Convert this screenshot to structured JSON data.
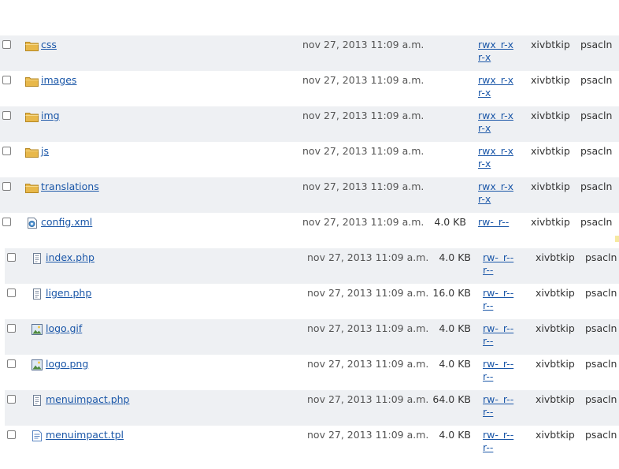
{
  "files": [
    {
      "name": "css",
      "type": "folder",
      "date": "nov 27, 2013 11:09 a.m.",
      "size": "",
      "perms": "rwx r-x r-x",
      "owner": "xivbtkip",
      "group": "psacln"
    },
    {
      "name": "images",
      "type": "folder",
      "date": "nov 27, 2013 11:09 a.m.",
      "size": "",
      "perms": "rwx r-x r-x",
      "owner": "xivbtkip",
      "group": "psacln"
    },
    {
      "name": "img",
      "type": "folder",
      "date": "nov 27, 2013 11:09 a.m.",
      "size": "",
      "perms": "rwx r-x r-x",
      "owner": "xivbtkip",
      "group": "psacln"
    },
    {
      "name": "js",
      "type": "folder",
      "date": "nov 27, 2013 11:09 a.m.",
      "size": "",
      "perms": "rwx r-x r-x",
      "owner": "xivbtkip",
      "group": "psacln"
    },
    {
      "name": "translations",
      "type": "folder",
      "date": "nov 27, 2013 11:09 a.m.",
      "size": "",
      "perms": "rwx r-x r-x",
      "owner": "xivbtkip",
      "group": "psacln"
    },
    {
      "name": "config.xml",
      "type": "xml",
      "date": "nov 27, 2013 11:09 a.m.",
      "size": "4.0 KB",
      "perms": "rw- r--",
      "owner": "xivbtkip",
      "group": "psacln"
    },
    {
      "name": "index.php",
      "type": "script",
      "date": "nov 27, 2013 11:09 a.m.",
      "size": "4.0 KB",
      "perms": "rw- r-- r--",
      "owner": "xivbtkip",
      "group": "psacln"
    },
    {
      "name": "ligen.php",
      "type": "script",
      "date": "nov 27, 2013 11:09 a.m.",
      "size": "16.0 KB",
      "perms": "rw- r-- r--",
      "owner": "xivbtkip",
      "group": "psacln"
    },
    {
      "name": "logo.gif",
      "type": "image",
      "date": "nov 27, 2013 11:09 a.m.",
      "size": "4.0 KB",
      "perms": "rw- r-- r--",
      "owner": "xivbtkip",
      "group": "psacln"
    },
    {
      "name": "logo.png",
      "type": "image",
      "date": "nov 27, 2013 11:09 a.m.",
      "size": "4.0 KB",
      "perms": "rw- r-- r--",
      "owner": "xivbtkip",
      "group": "psacln"
    },
    {
      "name": "menuimpact.php",
      "type": "script",
      "date": "nov 27, 2013 11:09 a.m.",
      "size": "64.0 KB",
      "perms": "rw- r-- r--",
      "owner": "xivbtkip",
      "group": "psacln"
    },
    {
      "name": "menuimpact.tpl",
      "type": "text",
      "date": "nov 27, 2013 11:09 a.m.",
      "size": "4.0 KB",
      "perms": "rw- r-- r--",
      "owner": "xivbtkip",
      "group": "psacln"
    }
  ],
  "icons": {
    "folder": "folder-icon",
    "xml": "xml-file-icon",
    "script": "script-file-icon",
    "image": "image-file-icon",
    "text": "text-file-icon"
  },
  "colors": {
    "link": "#1b57a8",
    "row_alt": "#eef0f3",
    "folder": "#e8b84a"
  }
}
